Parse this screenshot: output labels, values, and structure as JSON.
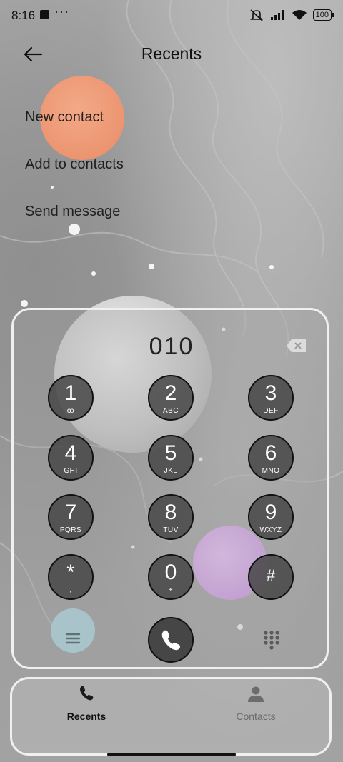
{
  "status_bar": {
    "time": "8:16",
    "more": "···",
    "battery": "100",
    "icons": [
      "mute-icon",
      "signal-icon",
      "wifi-icon",
      "battery-icon"
    ]
  },
  "header": {
    "title": "Recents",
    "back_icon": "arrow-left-icon"
  },
  "menu": {
    "new_contact": "New contact",
    "add_to_contacts": "Add to contacts",
    "send_message": "Send message"
  },
  "dialer": {
    "number": "010",
    "backspace_icon": "backspace-icon",
    "keys": [
      {
        "digit": "1",
        "letters": "ꝏ"
      },
      {
        "digit": "2",
        "letters": "ABC"
      },
      {
        "digit": "3",
        "letters": "DEF"
      },
      {
        "digit": "4",
        "letters": "GHI"
      },
      {
        "digit": "5",
        "letters": "JKL"
      },
      {
        "digit": "6",
        "letters": "MNO"
      },
      {
        "digit": "7",
        "letters": "PQRS"
      },
      {
        "digit": "8",
        "letters": "TUV"
      },
      {
        "digit": "9",
        "letters": "WXYZ"
      },
      {
        "digit": "*",
        "letters": ","
      },
      {
        "digit": "0",
        "letters": "+"
      },
      {
        "digit": "#",
        "letters": ""
      }
    ],
    "menu_icon": "hamburger-icon",
    "call_icon": "phone-icon",
    "keypad_icon": "keypad-icon"
  },
  "bottom_nav": {
    "recents": "Recents",
    "contacts": "Contacts"
  },
  "colors": {
    "accent_orange": "#f0a07a",
    "accent_purple": "#d8a6ee",
    "accent_teal": "#a9c8cf"
  }
}
